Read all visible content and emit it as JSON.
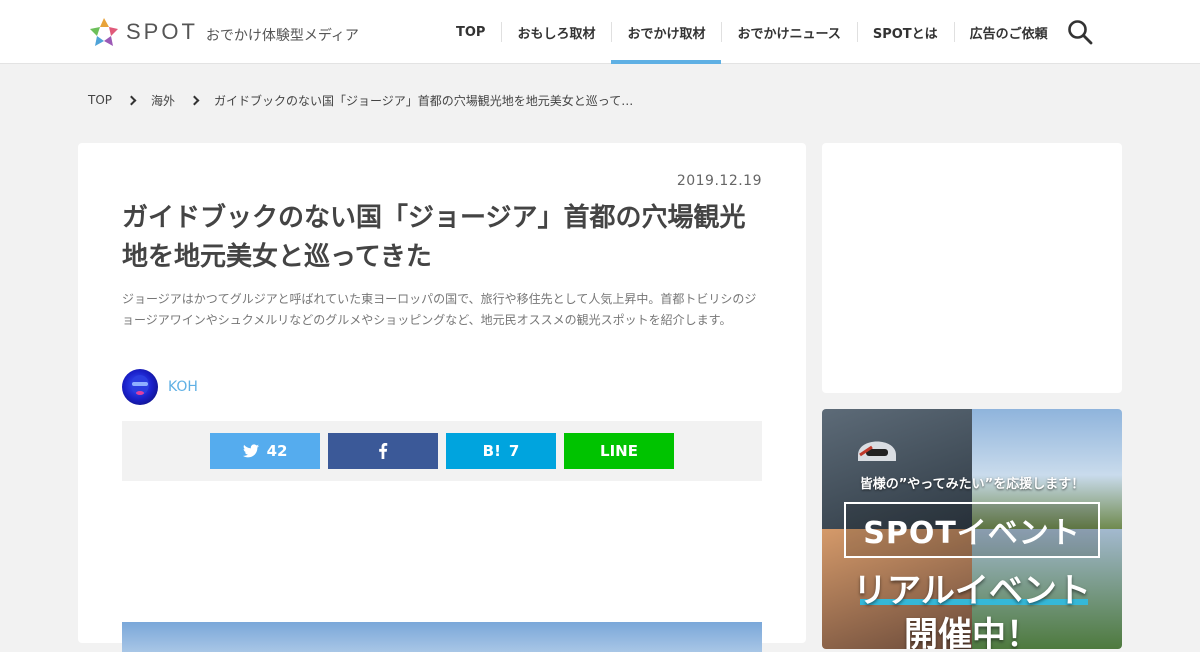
{
  "header": {
    "logo_text": "SPOT",
    "logo_sub": "おでかけ体験型メディア",
    "nav": [
      {
        "label": "TOP"
      },
      {
        "label": "おもしろ取材"
      },
      {
        "label": "おでかけ取材",
        "active": true
      },
      {
        "label": "おでかけニュース"
      },
      {
        "label": "SPOTとは"
      },
      {
        "label": "広告のご依頼"
      }
    ],
    "accent_color": "#5fb0e4"
  },
  "breadcrumb": {
    "items": [
      "TOP",
      "海外",
      "ガイドブックのない国「ジョージア」首都の穴場観光地を地元美女と巡って…"
    ]
  },
  "article": {
    "date": "2019.12.19",
    "title": "ガイドブックのない国「ジョージア」首都の穴場観光地を地元美女と巡ってきた",
    "lead": "ジョージアはかつてグルジアと呼ばれていた東ヨーロッパの国で、旅行や移住先として人気上昇中。首都トビリシのジョージアワインやシュクメルリなどのグルメやショッピングなど、地元民オススメの観光スポットを紹介します。",
    "author": "KOH"
  },
  "share": {
    "twitter_count": "42",
    "hatena_label": "B!",
    "hatena_count": "7",
    "line_label": "LINE",
    "colors": {
      "twitter": "#55acee",
      "facebook": "#3b5998",
      "hatena": "#00a4de",
      "line": "#00c300"
    }
  },
  "sidebar": {
    "banner": {
      "tagline": "皆様の”やってみたい”を応援します！",
      "event": "SPOTイベント",
      "real": "リアルイベント",
      "open": "開催中！"
    }
  }
}
